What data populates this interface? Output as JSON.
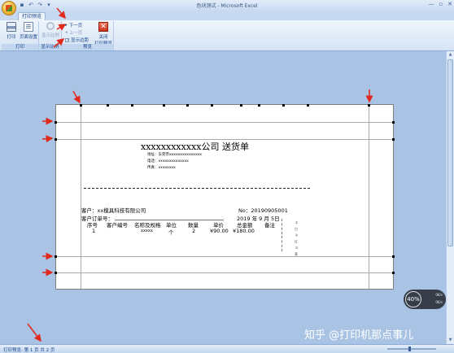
{
  "window": {
    "title": "色块测试 - Microsoft Excel",
    "qat": [
      "save-icon",
      "undo-icon",
      "redo-icon",
      "dropdown-icon"
    ],
    "controls": [
      "—",
      "▫",
      "✕"
    ]
  },
  "tabs": [
    {
      "label": "打印预览",
      "active": true
    }
  ],
  "ribbon": {
    "groups": [
      {
        "label": "打印",
        "buttons": [
          "打印",
          "页面设置"
        ]
      },
      {
        "label": "显示比例",
        "buttons": [
          "显示比例"
        ]
      },
      {
        "label": "预览",
        "buttons": [
          "下一页",
          "上一页",
          "显示边距",
          "关闭\n打印预览"
        ]
      }
    ],
    "print_label": "打印",
    "page_setup_label": "页面设置",
    "zoom_label": "显示比例",
    "next_page_label": "下一页",
    "prev_page_label": "上一页",
    "show_margins_label": "显示边距",
    "show_margins_checked": "✓",
    "close_label_1": "关闭",
    "close_label_2": "打印预览",
    "group_print": "打印",
    "group_zoom": "显示比例",
    "group_preview": "预览"
  },
  "document": {
    "title": "xxxxxxxxxxxx公司 送货单",
    "address": "地址：东莞市xxxxxxxxxxxxxxx",
    "phone": "电话：xxxxxxxxxxxxxx",
    "fax": "传真：xxxxxxxx",
    "customer": "客户：xx模具科技有限公司",
    "order_no_label": "客户订单号：",
    "number_prefix": "No：",
    "number": "20190905001",
    "date": "2019 年 9 月 5日",
    "table_headers": [
      "序号",
      "客户编号",
      "名称及规格",
      "单位",
      "数量",
      "单价",
      "总金额",
      "备注"
    ],
    "rows": [
      [
        "1",
        "",
        "xxxxx",
        "个",
        "2",
        "¥90.00",
        "¥180.00",
        ""
      ]
    ],
    "side_note": "① 白 ② 红 ③ 黄"
  },
  "zoom_overlay": {
    "value": "40%",
    "side_top": "0K/s",
    "side_bottom": "0K/s"
  },
  "watermark": "知乎 @打印机那点事儿",
  "status": {
    "text": "打印预览: 第 1 页 共 2 页"
  }
}
